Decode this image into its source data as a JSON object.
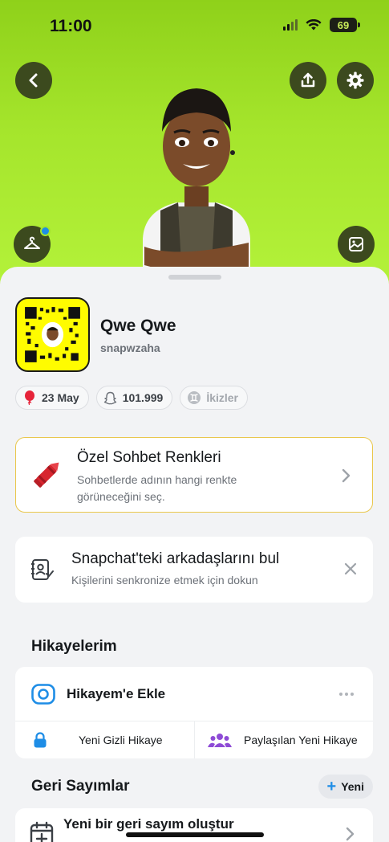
{
  "status": {
    "time": "11:00",
    "battery": "69"
  },
  "profile": {
    "display_name": "Qwe Qwe",
    "username": "snapwzaha"
  },
  "chips": [
    {
      "label": "23 May",
      "icon": "balloon-icon"
    },
    {
      "label": "101.999",
      "icon": "ghost-icon"
    },
    {
      "label": "İkizler",
      "icon": "gemini-icon"
    }
  ],
  "chat_colors": {
    "title": "Özel Sohbet Renkleri",
    "subtitle": "Sohbetlerde adının hangi renkte görüneceğini seç."
  },
  "find_friends": {
    "title": "Snapchat'teki arkadaşlarını bul",
    "subtitle": "Kişilerini senkronize etmek için dokun"
  },
  "stories": {
    "section_title": "Hikayelerim",
    "add_story": "Hikayem'e Ekle",
    "private_story": "Yeni Gizli Hikaye",
    "shared_story": "Paylaşılan Yeni Hikaye"
  },
  "countdowns": {
    "section_title": "Geri Sayımlar",
    "new_label": "Yeni",
    "create_title": "Yeni bir geri sayım oluştur"
  },
  "colors": {
    "header_green": "#a5e52c",
    "accent_blue": "#1e8de6",
    "snapcode_yellow": "#fffc00",
    "chat_card_border": "#e9c74c"
  }
}
